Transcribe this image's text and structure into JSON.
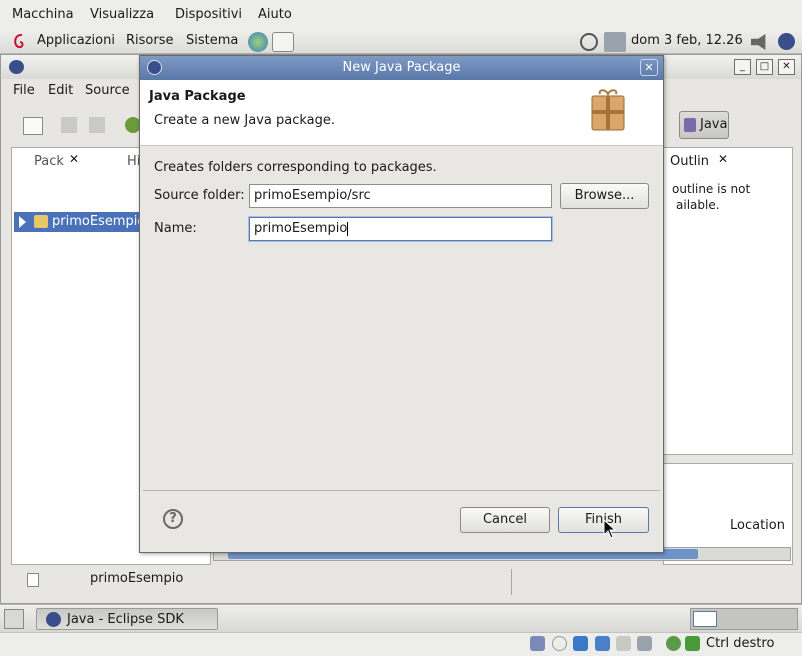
{
  "vbox_menu": {
    "items": [
      "Macchina",
      "Visualizza",
      "Dispositivi",
      "Aiuto"
    ],
    "status_hostkey": "Ctrl destro"
  },
  "gnome_panel": {
    "apps": "Applicazioni",
    "places": "Risorse",
    "system": "Sistema",
    "clock": "dom  3 feb, 12.26"
  },
  "eclipse": {
    "menu": [
      "File",
      "Edit",
      "Source"
    ],
    "perspective_label": "Java",
    "package_tab": "Pack",
    "hierarchy_tab": "Hi",
    "tree_item": "primoEsempio",
    "outline_tab": "Outlin",
    "outline_text": [
      "outline is not",
      "ailable."
    ],
    "location_header": "Location",
    "status_item": "primoEsempio"
  },
  "dialog": {
    "title": "New Java Package",
    "header_title": "Java Package",
    "header_desc": "Create a new Java package.",
    "info": "Creates folders corresponding to packages.",
    "source_folder_label": "Source folder:",
    "source_folder_value": "primoEsempio/src",
    "browse_label": "Browse...",
    "name_label": "Name:",
    "name_value": "primoEsempio",
    "cancel_label": "Cancel",
    "finish_label": "Finish"
  },
  "taskbar": {
    "window_button": "Java - Eclipse SDK"
  },
  "colors": {
    "dialog_title": "#5a78a8",
    "selection": "#4a72b8"
  }
}
